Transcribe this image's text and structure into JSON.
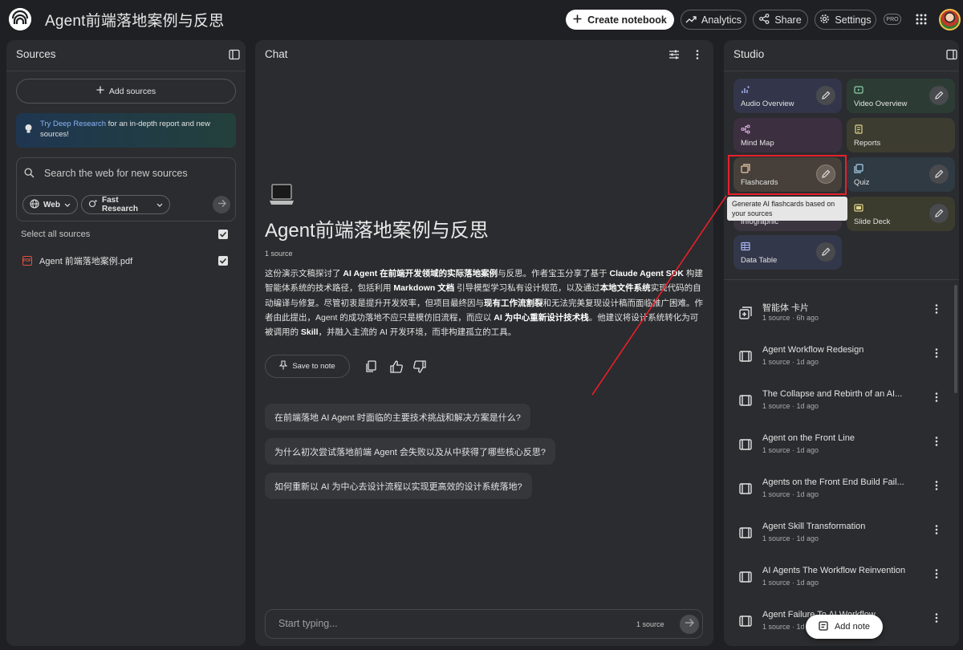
{
  "header": {
    "title": "Agent前端落地案例与反思",
    "create_label": "Create notebook",
    "analytics_label": "Analytics",
    "share_label": "Share",
    "settings_label": "Settings",
    "pro_label": "PRO"
  },
  "sources": {
    "title": "Sources",
    "add_label": "Add sources",
    "banner": {
      "link": "Try Deep Research",
      "text": " for an in-depth report and new sources!"
    },
    "search_placeholder": "Search the web for new sources",
    "web_chip": "Web",
    "fast_chip": "Fast Research",
    "select_all": "Select all sources",
    "items": [
      {
        "name": "Agent 前端落地案例.pdf",
        "checked": true
      }
    ]
  },
  "chat": {
    "title": "Chat",
    "notebook_title": "Agent前端落地案例与反思",
    "source_count": "1 source",
    "summary": {
      "p1": "这份演示文稿探讨了 ",
      "b1": "AI Agent 在前端开发领域的实际落地案例",
      "p2": "与反思。作者宝玉分享了基于 ",
      "b2": "Claude Agent SDK",
      "p3": " 构建智能体系统的技术路径，包括利用 ",
      "b3": "Markdown 文档",
      "p4": " 引导模型学习私有设计规范，以及通过",
      "b4": "本地文件系统",
      "p5": "实现代码的自动编译与修复。尽管初衷是提升开发效率，但项目最终因与",
      "b5": "现有工作流割裂",
      "p6": "和无法完美复现设计稿而面临推广困难。作者由此提出，Agent 的成功落地不应只是模仿旧流程，而应以 ",
      "b6": "AI 为中心重新设计技术栈",
      "p7": "。他建议将设计系统转化为可被调用的 ",
      "b7": "Skill",
      "p8": "，并融入主流的 AI 开发环境，而非构建孤立的工具。"
    },
    "save_note_label": "Save to note",
    "suggestions": [
      "在前端落地 AI Agent 时面临的主要技术挑战和解决方案是什么?",
      "为什么初次尝试落地前端 Agent 会失败以及从中获得了哪些核心反思?",
      "如何重新以 AI 为中心去设计流程以实现更高效的设计系统落地?"
    ],
    "input_placeholder": "Start typing...",
    "input_source_count": "1 source"
  },
  "studio": {
    "title": "Studio",
    "tiles": {
      "audio": "Audio Overview",
      "video": "Video Overview",
      "mind": "Mind Map",
      "reports": "Reports",
      "flash": "Flashcards",
      "quiz": "Quiz",
      "info": "Infographic",
      "slide": "Slide Deck",
      "table": "Data Table"
    },
    "tooltip": "Generate AI flashcards based on your sources",
    "notes": [
      {
        "title": "智能体 卡片",
        "meta": "1 source · 6h ago",
        "icon": "flashcard-icon"
      },
      {
        "title": "Agent Workflow Redesign",
        "meta": "1 source · 1d ago",
        "icon": "slide-deck-icon"
      },
      {
        "title": "The Collapse and Rebirth of an AI...",
        "meta": "1 source · 1d ago",
        "icon": "slide-deck-icon"
      },
      {
        "title": "Agent on the Front Line",
        "meta": "1 source · 1d ago",
        "icon": "slide-deck-icon"
      },
      {
        "title": "Agents on the Front End Build Fail...",
        "meta": "1 source · 1d ago",
        "icon": "slide-deck-icon"
      },
      {
        "title": "Agent Skill Transformation",
        "meta": "1 source · 1d ago",
        "icon": "slide-deck-icon"
      },
      {
        "title": "AI Agents The Workflow Reinvention",
        "meta": "1 source · 1d ago",
        "icon": "slide-deck-icon"
      },
      {
        "title": "Agent Failure To AI Workflow",
        "meta": "1 source · 1d ago",
        "icon": "slide-deck-icon"
      }
    ],
    "add_note_label": "Add note"
  },
  "colors": {
    "annotation": "#e8202a",
    "link": "#8ab4f8",
    "background": "#1f2023",
    "panel": "#2b2c2f"
  }
}
